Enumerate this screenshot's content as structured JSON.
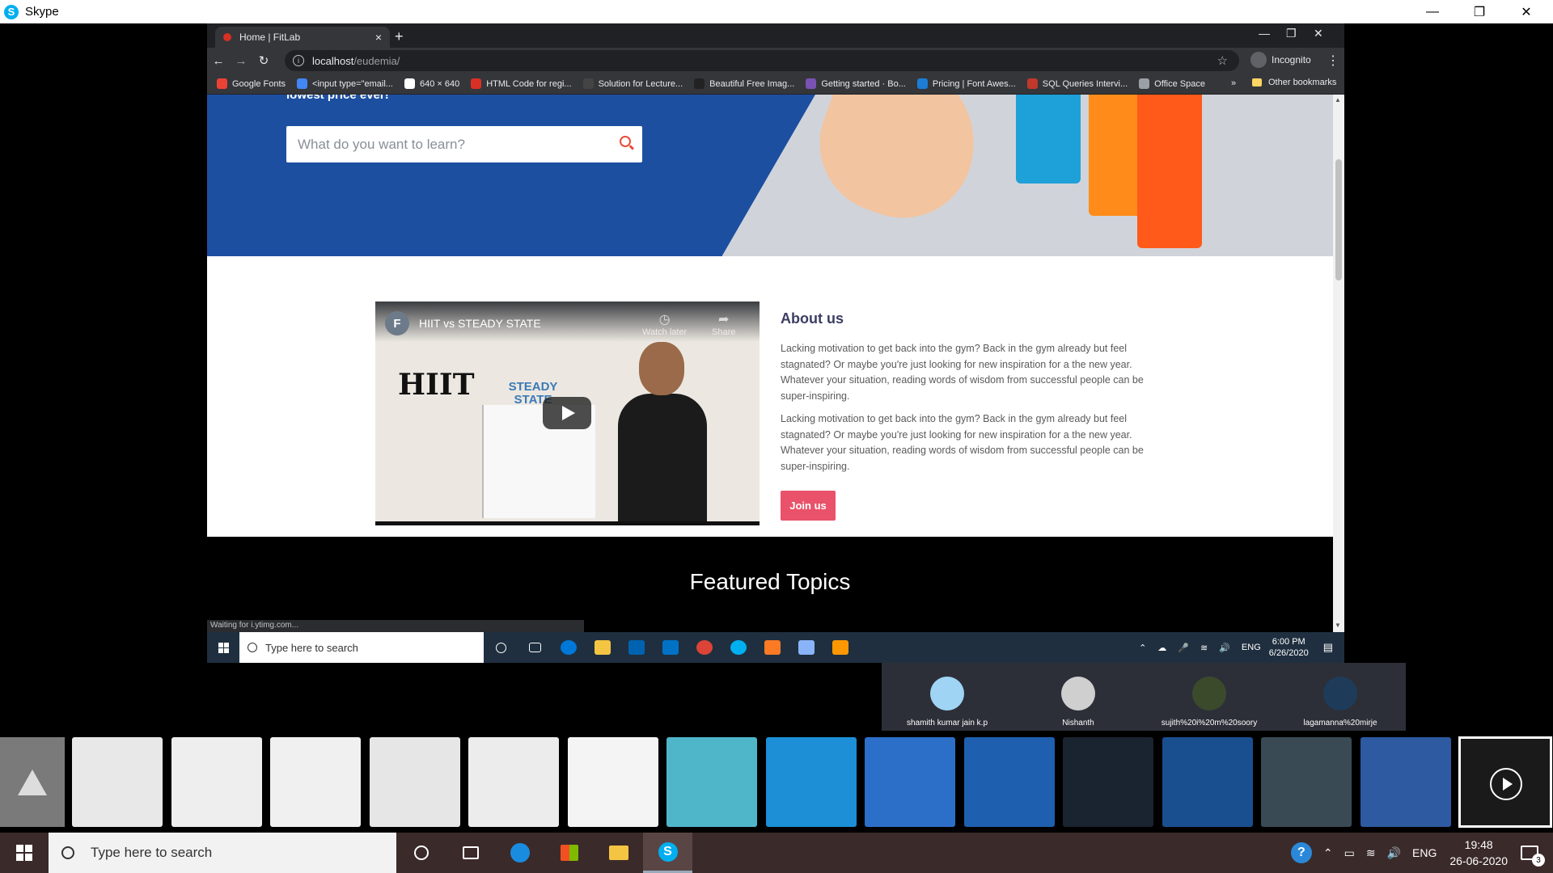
{
  "skype": {
    "title": "Skype",
    "logo_letter": "S"
  },
  "chrome": {
    "tab_title": "Home | FitLab",
    "new_tab": "+",
    "address_host": "localhost",
    "address_path": "/eudemia/",
    "incognito_label": "Incognito",
    "bookmarks": [
      {
        "label": "Google Fonts",
        "color": "#ea4335"
      },
      {
        "label": "<input type=\"email...",
        "color": "#4285f4"
      },
      {
        "label": "640 × 640",
        "color": "#ffffff"
      },
      {
        "label": "HTML Code for regi...",
        "color": "#d93025"
      },
      {
        "label": "Solution for Lecture...",
        "color": "#444444"
      },
      {
        "label": "Beautiful Free Imag...",
        "color": "#222222"
      },
      {
        "label": "Getting started · Bo...",
        "color": "#7952b3"
      },
      {
        "label": "Pricing | Font Awes...",
        "color": "#1c7cd6"
      },
      {
        "label": "SQL Queries Intervi...",
        "color": "#c0392b"
      },
      {
        "label": "Office Space",
        "color": "#9aa0a6"
      }
    ],
    "bookmarks_more": "»",
    "other_bookmarks": "Other bookmarks",
    "status_text": "Waiting for i.ytimg.com..."
  },
  "page": {
    "hero_text": "lowest price ever!",
    "search_placeholder": "What do you want to learn?",
    "video": {
      "channel_letter": "F",
      "title": "HIIT vs STEADY STATE",
      "watch_later": "Watch later",
      "share": "Share",
      "hiit_text": "HIIT",
      "steady_text": "STEADY STATE"
    },
    "about_title": "About us",
    "about_paragraphs": [
      "Lacking motivation to get back into the gym? Back in the gym already but feel stagnated? Or maybe you're just looking for new inspiration for a the new year. Whatever your situation, reading words of wisdom from successful people can be super-inspiring.",
      "Lacking motivation to get back into the gym? Back in the gym already but feel stagnated? Or maybe you're just looking for new inspiration for a the new year. Whatever your situation, reading words of wisdom from successful people can be super-inspiring."
    ],
    "join_button": "Join us",
    "featured_title": "Featured Topics"
  },
  "inner_taskbar": {
    "search_placeholder": "Type here to search",
    "language": "ENG",
    "time": "6:00 PM",
    "date": "6/26/2020",
    "apps": [
      {
        "name": "cortana",
        "color": "transparent"
      },
      {
        "name": "task-view",
        "color": "transparent"
      },
      {
        "name": "edge",
        "color": "#0078d7"
      },
      {
        "name": "file-explorer",
        "color": "#f4c542"
      },
      {
        "name": "store",
        "color": "#0063b1"
      },
      {
        "name": "mail",
        "color": "#0072c6"
      },
      {
        "name": "chrome",
        "color": "#db4437"
      },
      {
        "name": "skype",
        "color": "#00aff0"
      },
      {
        "name": "xampp",
        "color": "#fb7a24"
      },
      {
        "name": "notepad",
        "color": "#8ab4f8"
      },
      {
        "name": "sublime",
        "color": "#ff9800"
      }
    ]
  },
  "participants": [
    {
      "name": "shamith kumar jain k.p",
      "avatar_color": "#9fd4f5"
    },
    {
      "name": "Nishanth",
      "avatar_color": "#cfcfcf"
    },
    {
      "name": "sujith%20i%20m%20soory",
      "avatar_color": "#3c4a2c"
    },
    {
      "name": "lagamanna%20mirje",
      "avatar_color": "#1e3c5a"
    }
  ],
  "thumbnails": [
    {
      "name": "document",
      "color": "#e8e8e8"
    },
    {
      "name": "gantt-chart",
      "color": "#eeeeee"
    },
    {
      "name": "table-doc",
      "color": "#f0f0f0"
    },
    {
      "name": "wireframe-form",
      "color": "#e6e6e6"
    },
    {
      "name": "wireframe-login",
      "color": "#ececec"
    },
    {
      "name": "registration-form",
      "color": "#f4f4f4"
    },
    {
      "name": "teal-login",
      "color": "#4fb6c9"
    },
    {
      "name": "blue-login",
      "color": "#1c8fd6"
    },
    {
      "name": "welcome-back",
      "color": "#2c6fc9"
    },
    {
      "name": "find-topics",
      "color": "#1f5fb0"
    },
    {
      "name": "dark-menu",
      "color": "#1a2330"
    },
    {
      "name": "blue-menu",
      "color": "#1a4f8f"
    },
    {
      "name": "fitness-site",
      "color": "#3a4a55"
    },
    {
      "name": "fitlab-site",
      "color": "#2d5aa0"
    }
  ],
  "taskbar": {
    "search_placeholder": "Type here to search",
    "language": "ENG",
    "time": "19:48",
    "date": "26-06-2020",
    "notification_count": "3"
  }
}
